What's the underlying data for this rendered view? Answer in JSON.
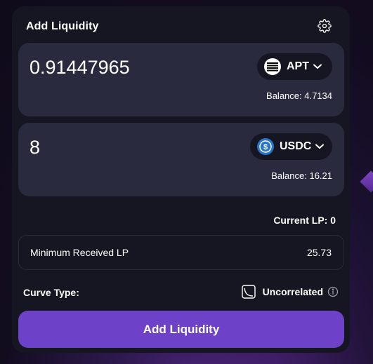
{
  "card": {
    "title": "Add Liquidity",
    "settings_icon": "gear-icon"
  },
  "token_a": {
    "amount": "0.91447965",
    "symbol": "APT",
    "icon": "apt-token-icon",
    "balance_text": "Balance: 4.7134"
  },
  "token_b": {
    "amount": "8",
    "symbol": "USDC",
    "icon": "usdc-token-icon",
    "balance_text": "Balance: 16.21"
  },
  "current_lp_text": "Current LP: 0",
  "minimum_received": {
    "label": "Minimum Received LP",
    "value": "25.73"
  },
  "curve": {
    "label": "Curve Type:",
    "value": "Uncorrelated",
    "icon": "curve-uncorrelated-icon",
    "info_icon": "info-icon"
  },
  "submit_button_label": "Add Liquidity",
  "colors": {
    "card_bg": "#161622",
    "panel_bg": "#2a2a3e",
    "accent": "#6d42c8",
    "usdc_blue": "#2775ca"
  }
}
